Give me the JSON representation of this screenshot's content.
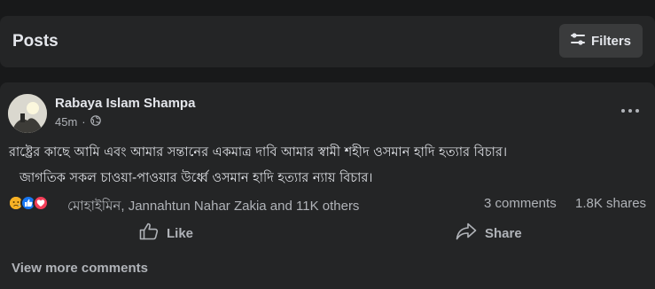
{
  "header": {
    "title": "Posts",
    "filters_label": "Filters"
  },
  "post": {
    "author": "Rabaya Islam Shampa",
    "time": "45m",
    "text_line1": "রাষ্ট্রের কাছে আমি এবং আমার সন্তানের একমাত্র দাবি আমার স্বামী শহীদ ওসমান হাদি হত্যার বিচার।",
    "text_line2": "জাগতিক সকল চাওয়া-পাওয়ার উর্ধ্বে  ওসমান হাদি হত্যার ন্যায় বিচার।",
    "reactions": [
      "sad-icon",
      "like-icon",
      "love-icon"
    ],
    "reaction_summary": "মোহাইমিন, Jannahtun Nahar Zakia and 11K others",
    "comments_count": "3 comments",
    "shares_count": "1.8K shares",
    "like_label": "Like",
    "share_label": "Share",
    "view_more_label": "View more comments"
  },
  "colors": {
    "background": "#18191a",
    "card": "#242526",
    "button": "#3a3b3c",
    "primary_text": "#e4e6eb",
    "secondary_text": "#b0b3b8",
    "like_blue": "#1877f2",
    "love_red": "#f33e58",
    "sad_yellow": "#f7b125"
  }
}
